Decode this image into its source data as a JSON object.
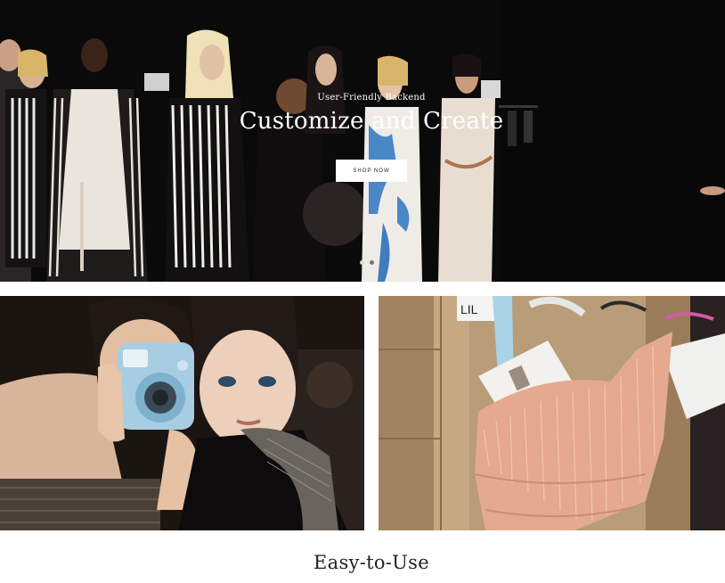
{
  "hero": {
    "subtitle": "User-Friendly Backend",
    "title": "Customize and Create",
    "button_label": "SHOP NOW",
    "slides": 2,
    "active_slide": 1
  },
  "photos": {
    "left_label": "LIL"
  },
  "section": {
    "title": "Easy-to-Use"
  },
  "colors": {
    "hero_bg": "#0b0a0a",
    "button_bg": "#ffffff",
    "text_dark": "#222222",
    "accent_pink": "#e9a48f"
  }
}
